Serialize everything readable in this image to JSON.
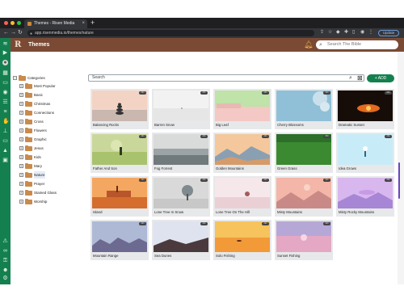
{
  "browser": {
    "tab_title": "Themes - Risen Media",
    "new_tab_icon": "+",
    "url": "app.risenmedia.io/themes/nature",
    "update_label": "Update",
    "window_controls": [
      "#ff5f57",
      "#febc2e",
      "#28c840"
    ]
  },
  "header": {
    "title": "Themes",
    "search_placeholder": "Search The Bible",
    "brand_color": "#7a4a35"
  },
  "rail": {
    "color": "#15804f",
    "top_icons": [
      "wifi-icon",
      "play-icon",
      "user-avatar",
      "grid-icon",
      "book-icon",
      "play-circle-icon",
      "list-icon",
      "stack-icon",
      "hand-icon",
      "network-icon",
      "monitor-icon",
      "graduation-icon",
      "save-icon"
    ],
    "bottom_icons": [
      "warning-icon",
      "link-icon",
      "key-icon",
      "user-icon",
      "gear-icon",
      "exit-icon"
    ]
  },
  "tree": {
    "root_label": "Categories",
    "items": [
      {
        "label": "Most Popular",
        "selected": false
      },
      {
        "label": "Basic",
        "selected": false
      },
      {
        "label": "Christmas",
        "selected": false
      },
      {
        "label": "Connections",
        "selected": false
      },
      {
        "label": "Cross",
        "selected": false
      },
      {
        "label": "Flowers",
        "selected": false
      },
      {
        "label": "Graphic",
        "selected": false
      },
      {
        "label": "Jesus",
        "selected": false
      },
      {
        "label": "Kids",
        "selected": false
      },
      {
        "label": "Mary",
        "selected": false
      },
      {
        "label": "Nature",
        "selected": true
      },
      {
        "label": "Prayer",
        "selected": false
      },
      {
        "label": "Stained Glass",
        "selected": false
      },
      {
        "label": "Worship",
        "selected": false
      }
    ]
  },
  "main": {
    "search_placeholder": "Search",
    "add_label": "+ ADD",
    "menu_label": "•••",
    "themes": [
      "Balancing Rocks",
      "Barren Snow",
      "Big Leaf",
      "Cherry Blossoms",
      "Dramatic Sunset",
      "Father And Son",
      "Fog Forrest",
      "Golden Mountains",
      "Green Grass",
      "Idea Grows",
      "Island",
      "Lone Tree In Snow",
      "Lone Tree On The Hill",
      "Misty Mountains",
      "Misty Rocky Mountains",
      "Mountain Range",
      "Sea Dunes",
      "Solo Fishing",
      "Sunset Fishing"
    ]
  }
}
